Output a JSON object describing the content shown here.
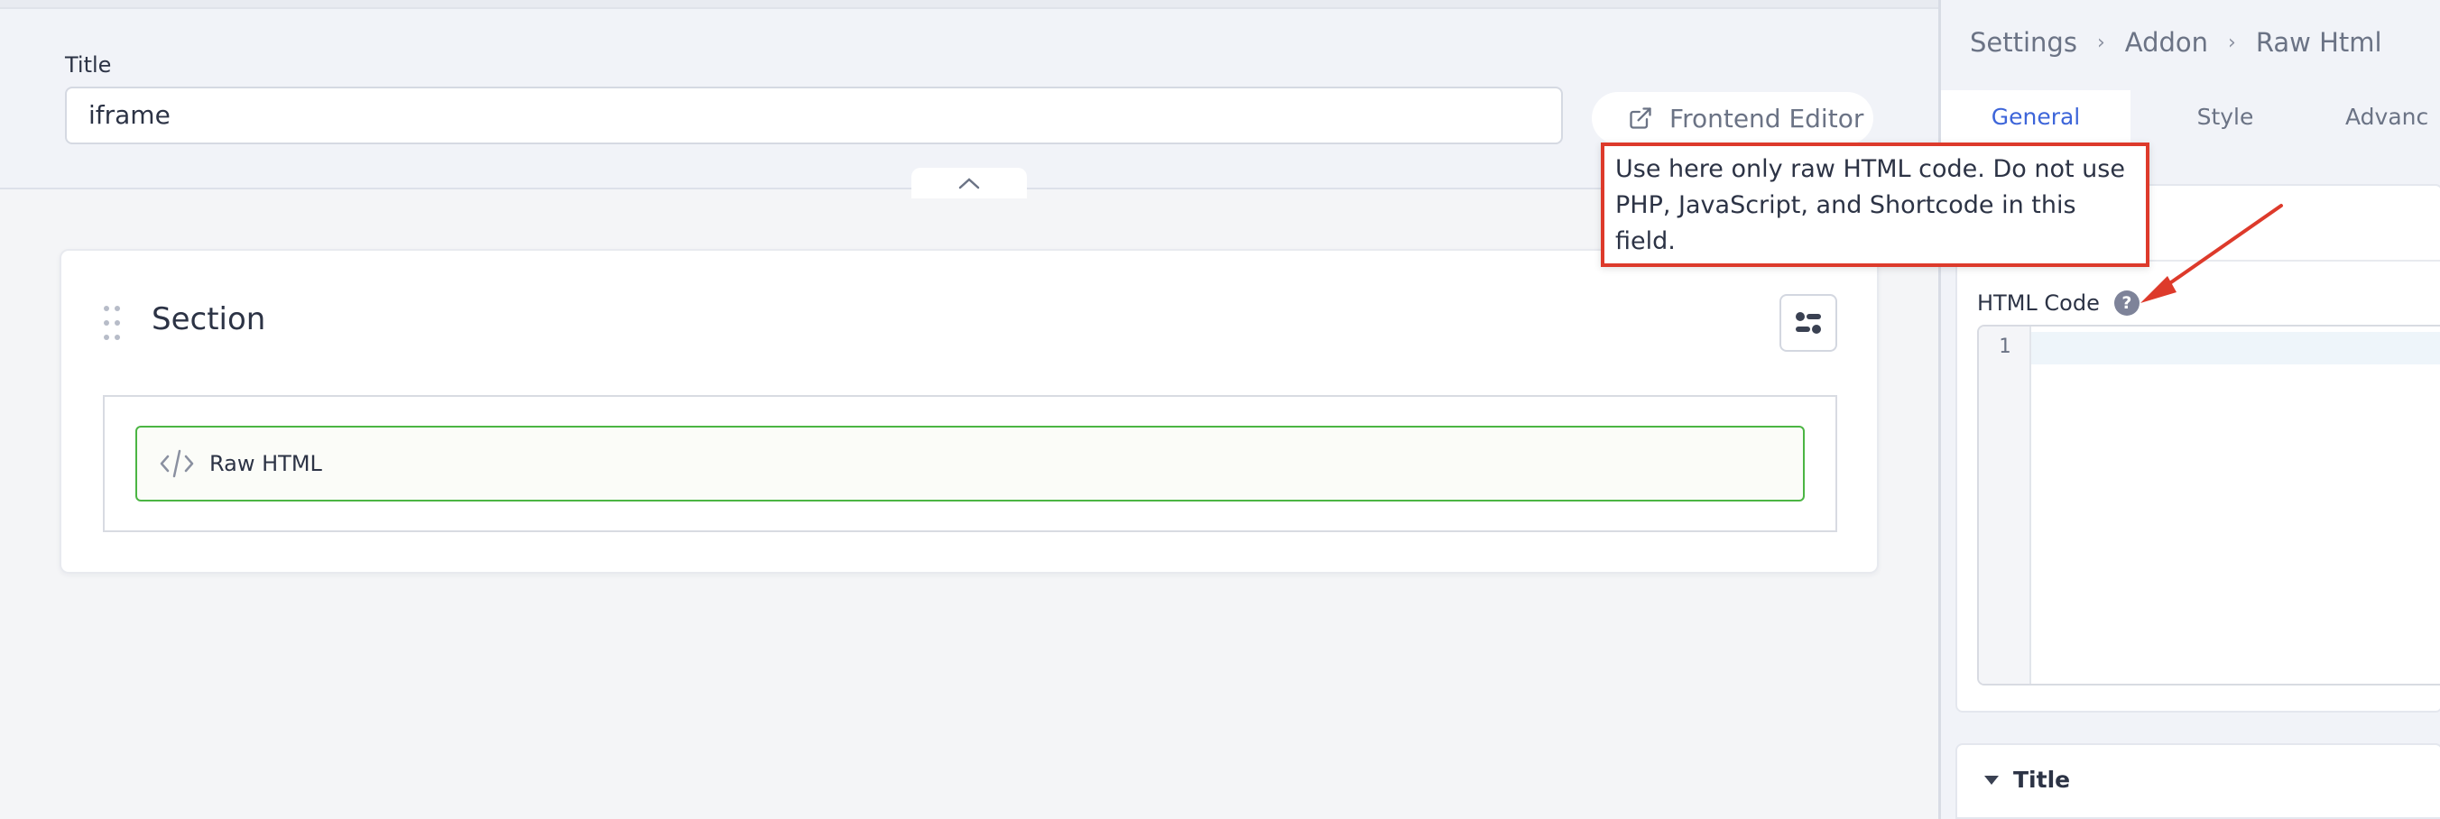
{
  "title_field": {
    "label": "Title",
    "value": "iframe"
  },
  "toolbar": {
    "frontend_editor_label": "Frontend Editor"
  },
  "section": {
    "title": "Section",
    "addon_label": "Raw HTML"
  },
  "panel": {
    "breadcrumb": [
      "Settings",
      "Addon",
      "Raw Html"
    ],
    "tabs": [
      {
        "label": "General",
        "active": true
      },
      {
        "label": "Style",
        "active": false
      },
      {
        "label": "Advanc",
        "active": false
      }
    ],
    "html_code_label": "HTML Code",
    "line_number": "1",
    "title_group_label": "Title"
  },
  "tooltip": {
    "text": "Use here only raw HTML code. Do not use PHP, JavaScript, and Shortcode in this field."
  },
  "colors": {
    "accent": "#3d65d9",
    "addon_border": "#4bb543",
    "annotation": "#dd3a2b"
  },
  "icons": {
    "external_link": "external-link-icon",
    "collapse": "chevron-up-icon",
    "drag": "drag-handle-icon",
    "settings": "toggle-settings-icon",
    "code": "code-icon",
    "help": "help-icon",
    "caret": "caret-down-icon"
  }
}
